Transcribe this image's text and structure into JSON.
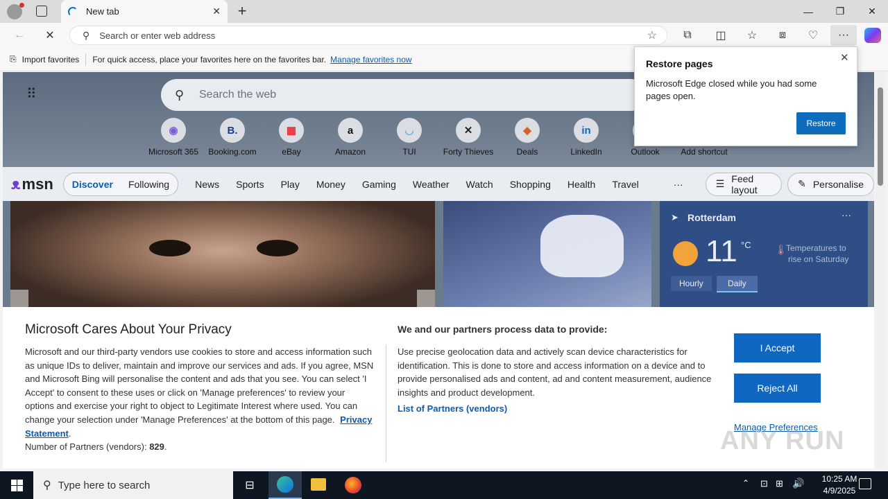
{
  "browser": {
    "tab_title": "New tab",
    "address_placeholder": "Search or enter web address",
    "favorites_import": "Import favorites",
    "favorites_hint": "For quick access, place your favorites here on the favorites bar.",
    "favorites_link": "Manage favorites now"
  },
  "restore_popup": {
    "title": "Restore pages",
    "message": "Microsoft Edge closed while you had some pages open.",
    "button": "Restore"
  },
  "newtab": {
    "search_placeholder": "Search the web",
    "shortcuts": [
      {
        "label": "Microsoft 365",
        "glyph": "◉",
        "color": "#7b5cd6"
      },
      {
        "label": "Booking.com",
        "glyph": "B.",
        "color": "#1a3d8f"
      },
      {
        "label": "eBay",
        "glyph": "▦",
        "color": "#e53238"
      },
      {
        "label": "Amazon",
        "glyph": "a",
        "color": "#111"
      },
      {
        "label": "TUI",
        "glyph": "◡",
        "color": "#5ab4e6"
      },
      {
        "label": "Forty Thieves",
        "glyph": "✕",
        "color": "#222"
      },
      {
        "label": "Deals",
        "glyph": "◆",
        "color": "#d9602b"
      },
      {
        "label": "LinkedIn",
        "glyph": "in",
        "color": "#0a66c2"
      },
      {
        "label": "Outlook",
        "glyph": "",
        "color": "#0f6cbd"
      },
      {
        "label": "Add shortcut",
        "glyph": "",
        "color": "#555"
      }
    ]
  },
  "msn": {
    "logo": "msn",
    "tabs": [
      "Discover",
      "Following"
    ],
    "nav": [
      "News",
      "Sports",
      "Play",
      "Money",
      "Gaming",
      "Weather",
      "Watch",
      "Shopping",
      "Health",
      "Travel"
    ],
    "more": "···",
    "feed_layout": "Feed layout",
    "personalise": "Personalise"
  },
  "weather": {
    "city": "Rotterdam",
    "temp": "11",
    "unit": "°C",
    "note_line1": "Temperatures to",
    "note_line2": "rise on Saturday",
    "tabs": [
      "Hourly",
      "Daily"
    ]
  },
  "privacy": {
    "title": "Microsoft Cares About Your Privacy",
    "body": "Microsoft and our third-party vendors use cookies to store and access information such as unique IDs to deliver, maintain and improve our services and ads. If you agree, MSN and Microsoft Bing will personalise the content and ads that you see. You can select 'I Accept' to consent to these uses or click on 'Manage preferences' to review your options and exercise your right to object to Legitimate Interest where used.  You can change your selection under 'Manage Preferences' at the bottom of this page.",
    "privacy_link": "Privacy Statement",
    "partners_label": "Number of Partners (vendors):",
    "partners_count": "829",
    "right_title": "We and our partners process data to provide:",
    "right_body": "Use precise geolocation data and actively scan device characteristics for identification. This is done to store and access information on a device and to provide personalised ads and content, ad and content measurement, audience insights and product development.",
    "list_link": "List of Partners (vendors)",
    "accept": "I Accept",
    "reject": "Reject All",
    "manage": "Manage Preferences"
  },
  "taskbar": {
    "search_placeholder": "Type here to search",
    "time": "10:25 AM",
    "date": "4/9/2025"
  },
  "watermark": "ANY RUN"
}
